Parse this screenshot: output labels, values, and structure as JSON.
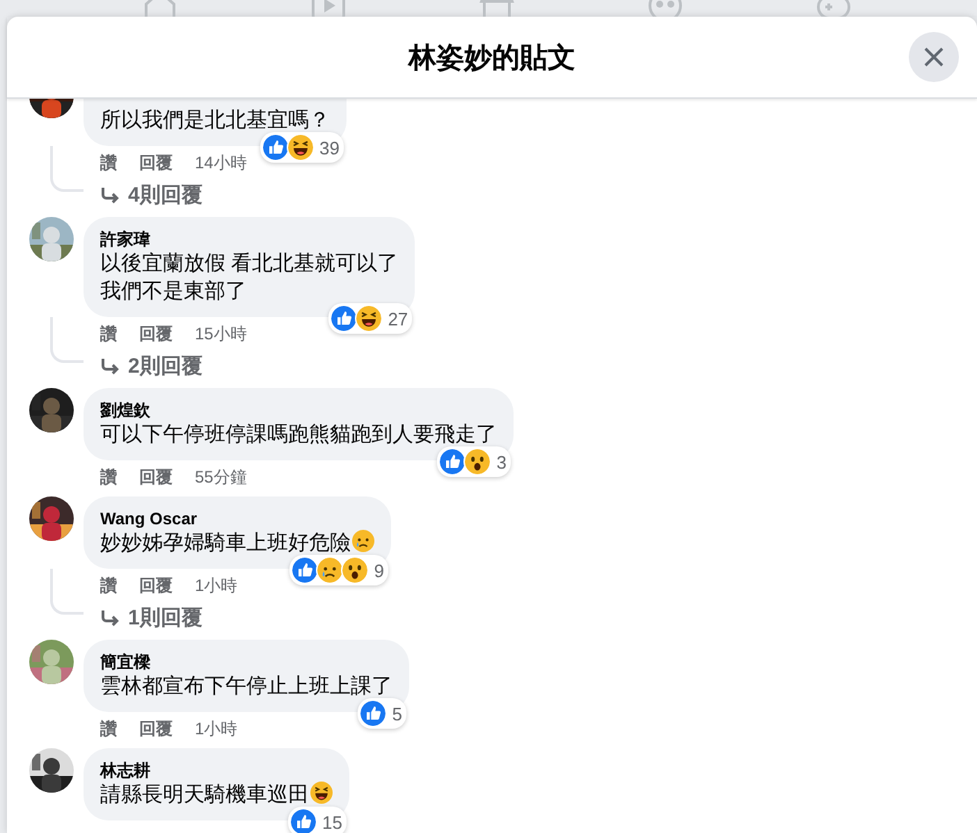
{
  "title": "林姿妙的貼文",
  "comments": [
    {
      "lines": [
        "所以我們是北北基宜嗎？"
      ],
      "actions": [
        "讚",
        "回覆"
      ],
      "time": "14小時",
      "reactions": [
        {
          "kind": "like"
        },
        {
          "kind": "haha"
        }
      ],
      "count": "39",
      "replies": "4則回覆"
    },
    {
      "name": "許家瑋",
      "lines": [
        "以後宜蘭放假 看北北基就可以了",
        "我們不是東部了"
      ],
      "actions": [
        "讚",
        "回覆"
      ],
      "time": "15小時",
      "reactions": [
        {
          "kind": "like"
        },
        {
          "kind": "haha"
        }
      ],
      "count": "27",
      "replies": "2則回覆"
    },
    {
      "name": "劉煌欽",
      "lines": [
        "可以下午停班停課嗎跑熊貓跑到人要飛走了"
      ],
      "actions": [
        "讚",
        "回覆"
      ],
      "time": "55分鐘",
      "reactions": [
        {
          "kind": "like"
        },
        {
          "kind": "wow"
        }
      ],
      "count": "3"
    },
    {
      "name": "Wang Oscar",
      "lines": [
        "妙妙姊孕婦騎車上班好危險"
      ],
      "text_emoji": {
        "kind": "sad"
      },
      "actions": [
        "讚",
        "回覆"
      ],
      "time": "1小時",
      "reactions": [
        {
          "kind": "like"
        },
        {
          "kind": "sad"
        },
        {
          "kind": "wow"
        }
      ],
      "count": "9",
      "replies": "1則回覆"
    },
    {
      "name": "簡宜樑",
      "lines": [
        "雲林都宣布下午停止上班上課了"
      ],
      "actions": [
        "讚",
        "回覆"
      ],
      "time": "1小時",
      "reactions": [
        {
          "kind": "like"
        }
      ],
      "count": "5"
    },
    {
      "name": "林志耕",
      "lines": [
        "請縣長明天騎機車巡田"
      ],
      "text_emoji": {
        "kind": "haha"
      },
      "reactions": [
        {
          "kind": "like"
        }
      ],
      "count": "15"
    }
  ]
}
